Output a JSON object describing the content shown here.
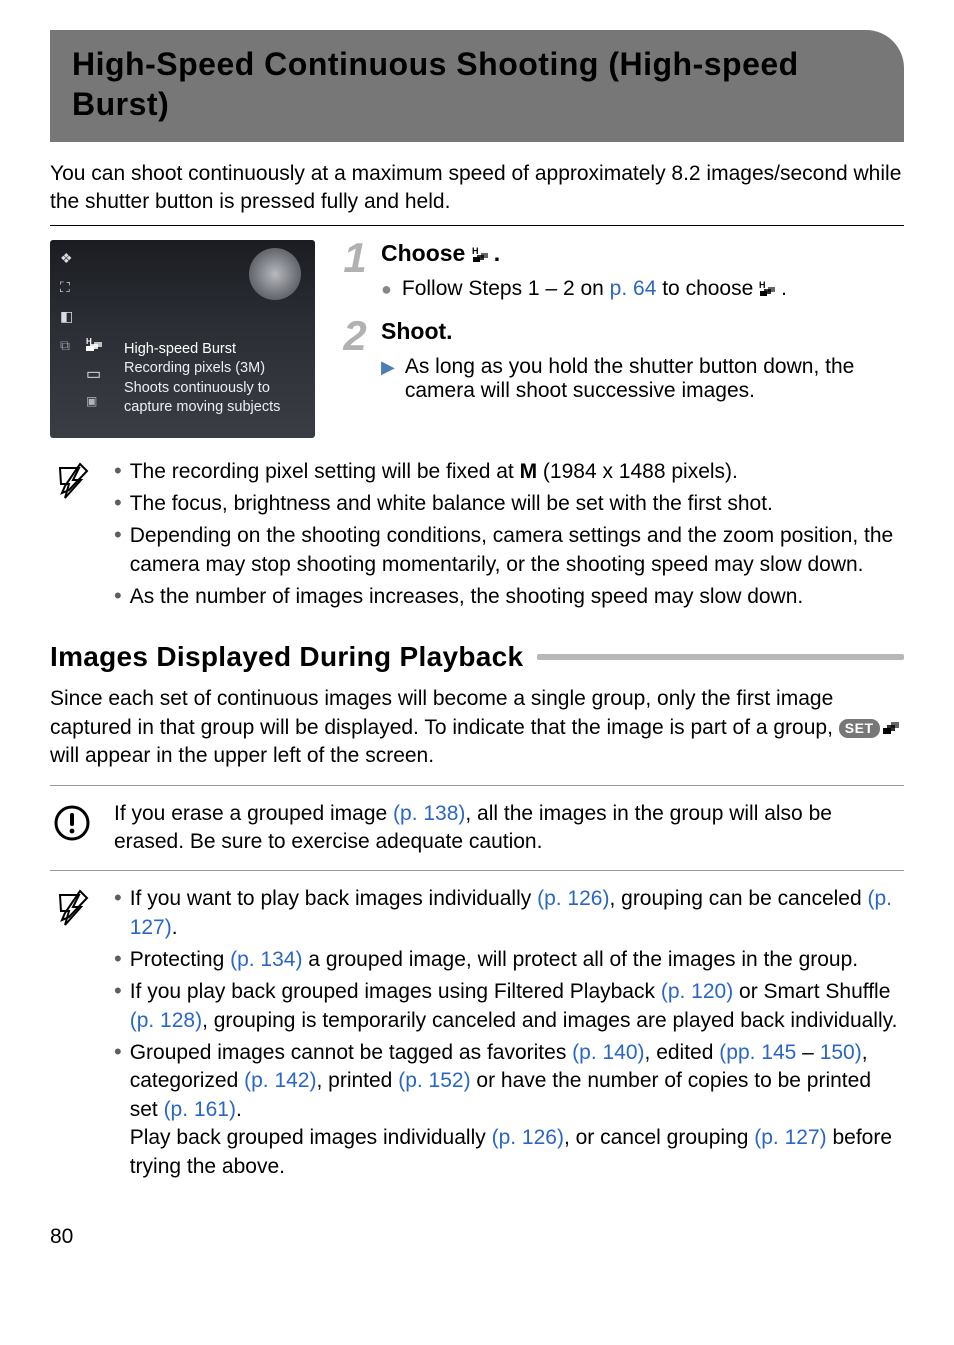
{
  "title": "High-Speed Continuous Shooting (High-speed Burst)",
  "intro": "You can shoot continuously at a maximum speed of approximately 8.2 images/second while the shutter button is pressed fully and held.",
  "camera_screen": {
    "mode_label": "High-speed Burst",
    "desc1": "Recording pixels (3M)",
    "desc2": "Shoots continuously to",
    "desc3": "capture moving subjects"
  },
  "step1": {
    "num": "1",
    "heading_pre": "Choose ",
    "heading_post": ".",
    "bullet_pre": "Follow Steps 1 – 2 on ",
    "bullet_link": "p. 64",
    "bullet_post": " to choose ",
    "bullet_tail": "."
  },
  "step2": {
    "num": "2",
    "heading": "Shoot.",
    "bullet": "As long as you hold the shutter button down, the camera will shoot successive images."
  },
  "notes1": [
    {
      "pre": "The recording pixel setting will be fixed at ",
      "glyph": "M",
      "post": " (1984 x 1488 pixels)."
    },
    {
      "text": "The focus, brightness and white balance will be set with the first shot."
    },
    {
      "text": "Depending on the shooting conditions, camera settings and the zoom position, the camera may stop shooting momentarily, or the shooting speed may slow down."
    },
    {
      "text": "As the number of images increases, the shooting speed may slow down."
    }
  ],
  "section2_heading": "Images Displayed During Playback",
  "section2_para_pre": "Since each set of continuous images will become a single group, only the first image captured in that group will be displayed. To indicate that the image is part of a group, ",
  "section2_para_post": " will appear in the upper left of the screen.",
  "set_label": "SET",
  "caution": {
    "pre": "If you erase a grouped image ",
    "link": "(p. 138)",
    "post": ", all the images in the group will also be erased. Be sure to exercise adequate caution."
  },
  "notes2": {
    "n1": {
      "pre": "If you want to play back images individually ",
      "l1": "(p. 126)",
      "mid": ", grouping can be canceled ",
      "l2": "(p. 127)",
      "post": "."
    },
    "n2": {
      "pre": "Protecting ",
      "l1": "(p. 134)",
      "post": " a grouped image, will protect all of the images in the group."
    },
    "n3": {
      "pre": "If you play back grouped images using Filtered Playback ",
      "l1": "(p. 120)",
      "mid": " or Smart Shuffle ",
      "l2": "(p. 128)",
      "post": ", grouping is temporarily canceled and images are played back individually."
    },
    "n4a": {
      "pre": "Grouped images cannot be tagged as favorites ",
      "l1": "(p. 140)",
      "mid1": ", edited ",
      "l2": "(pp. 145",
      "mid2": " – ",
      "l3": "150)",
      "mid3": ", categorized ",
      "l4": "(p. 142)",
      "mid4": ", printed ",
      "l5": "(p. 152)",
      "mid5": " or have the number of copies to be printed set ",
      "l6": "(p. 161)",
      "post": "."
    },
    "n4b": {
      "pre": "Play back grouped images individually ",
      "l1": "(p. 126)",
      "mid": ", or cancel grouping ",
      "l2": "(p. 127)",
      "post": " before trying the above."
    }
  },
  "page_number": "80"
}
